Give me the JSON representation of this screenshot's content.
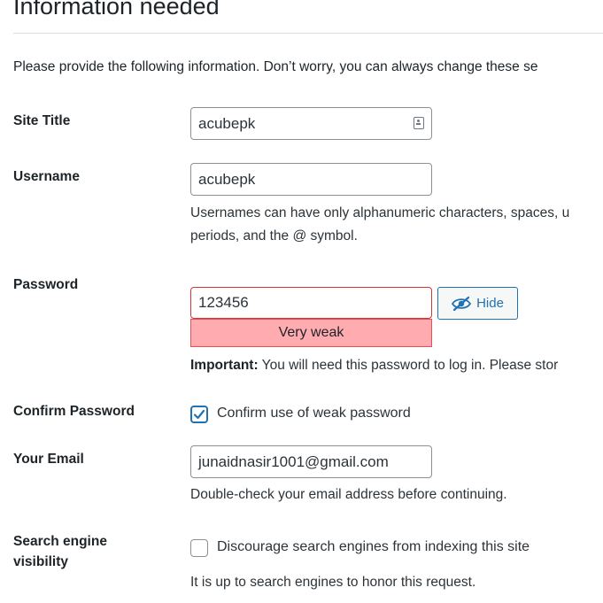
{
  "heading": "Information needed",
  "intro": "Please provide the following information. Don’t worry, you can always change these se",
  "site_title": {
    "label": "Site Title",
    "value": "acubepk",
    "icon": "contact-card-icon"
  },
  "username": {
    "label": "Username",
    "value": "acubepk",
    "help_line1": "Usernames can have only alphanumeric characters, spaces, u",
    "help_line2": "periods, and the @ symbol."
  },
  "password": {
    "label": "Password",
    "value": "123456",
    "hide_label": "Hide",
    "hide_icon": "eye-slash-icon",
    "strength": "Very weak",
    "important_prefix": "Important:",
    "important_text": " You will need this password to log in. Please stor"
  },
  "confirm_password": {
    "label": "Confirm Password",
    "checkbox_label": "Confirm use of weak password",
    "checked": true
  },
  "email": {
    "label": "Your Email",
    "value": "junaidnasir1001@gmail.com",
    "help": "Double-check your email address before continuing."
  },
  "search_visibility": {
    "label_line1": "Search engine",
    "label_line2": "visibility",
    "checkbox_label": "Discourage search engines from indexing this site",
    "checked": false,
    "help": "It is up to search engines to honor this request."
  },
  "colors": {
    "accent": "#2271b1",
    "weak_bg": "#ffabaf",
    "weak_border": "#d63638"
  }
}
